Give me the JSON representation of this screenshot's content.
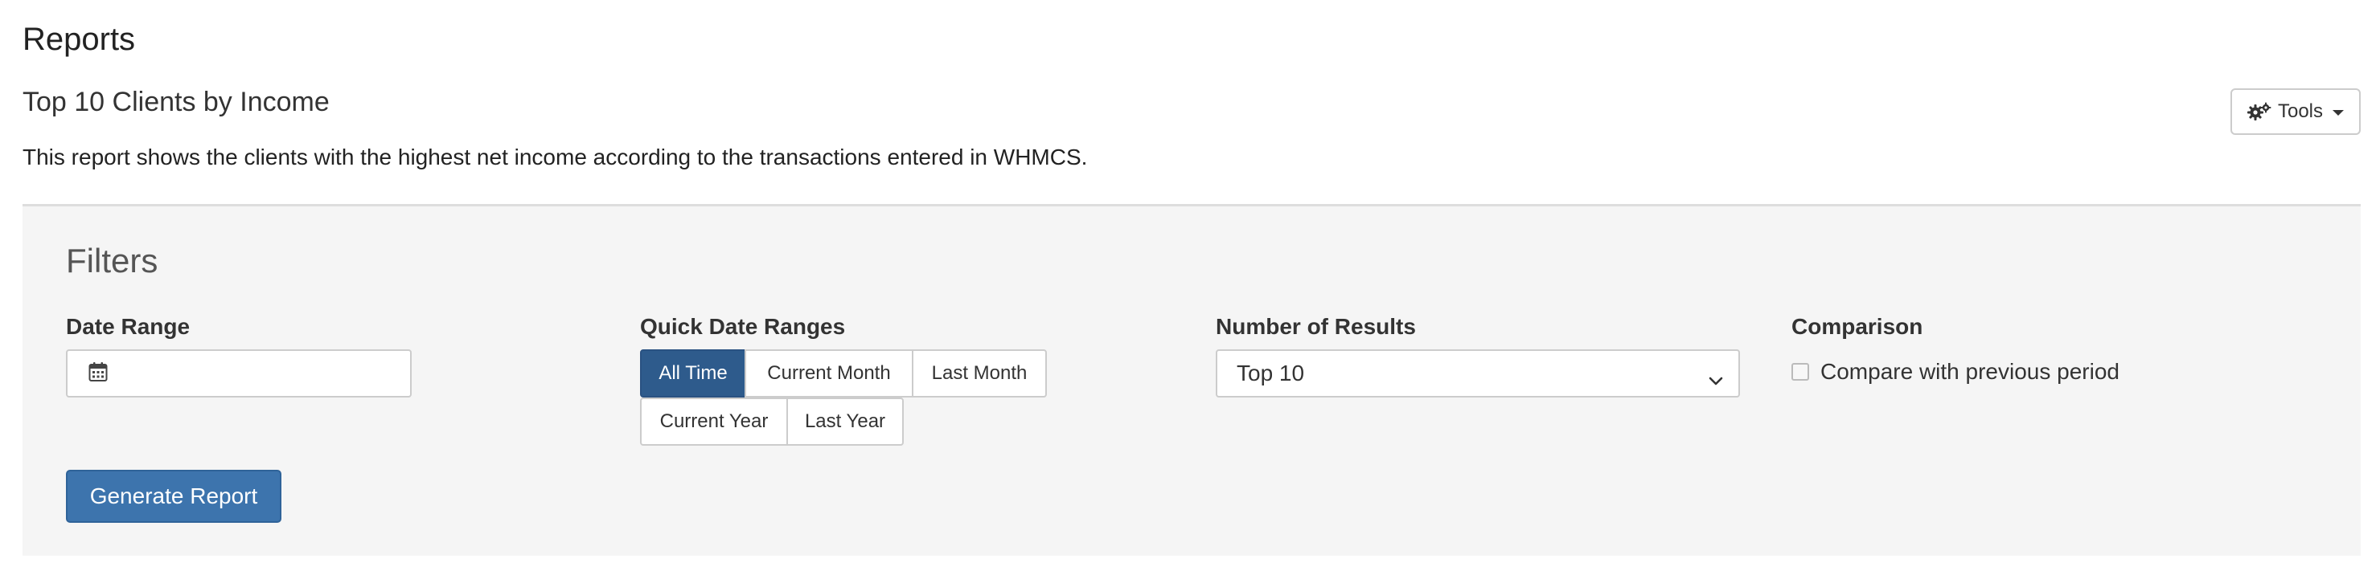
{
  "page": {
    "title": "Reports"
  },
  "report": {
    "title": "Top 10 Clients by Income",
    "description": "This report shows the clients with the highest net income according to the transactions entered in WHMCS."
  },
  "toolbar": {
    "tools_label": "Tools",
    "tools_icon": "gears-icon"
  },
  "filters": {
    "heading": "Filters",
    "date_range": {
      "label": "Date Range",
      "value": "",
      "icon": "calendar-icon"
    },
    "quick_ranges": {
      "label": "Quick Date Ranges",
      "options": [
        "All Time",
        "Current Month",
        "Last Month",
        "Current Year",
        "Last Year"
      ],
      "selected": "All Time"
    },
    "results": {
      "label": "Number of Results",
      "selected": "Top 10"
    },
    "comparison": {
      "label": "Comparison",
      "checkbox_label": "Compare with previous period",
      "checked": false
    },
    "generate_label": "Generate Report"
  },
  "colors": {
    "accent": "#2e5b8c",
    "primary_button": "#3d74ad",
    "panel_bg": "#f5f5f5"
  }
}
